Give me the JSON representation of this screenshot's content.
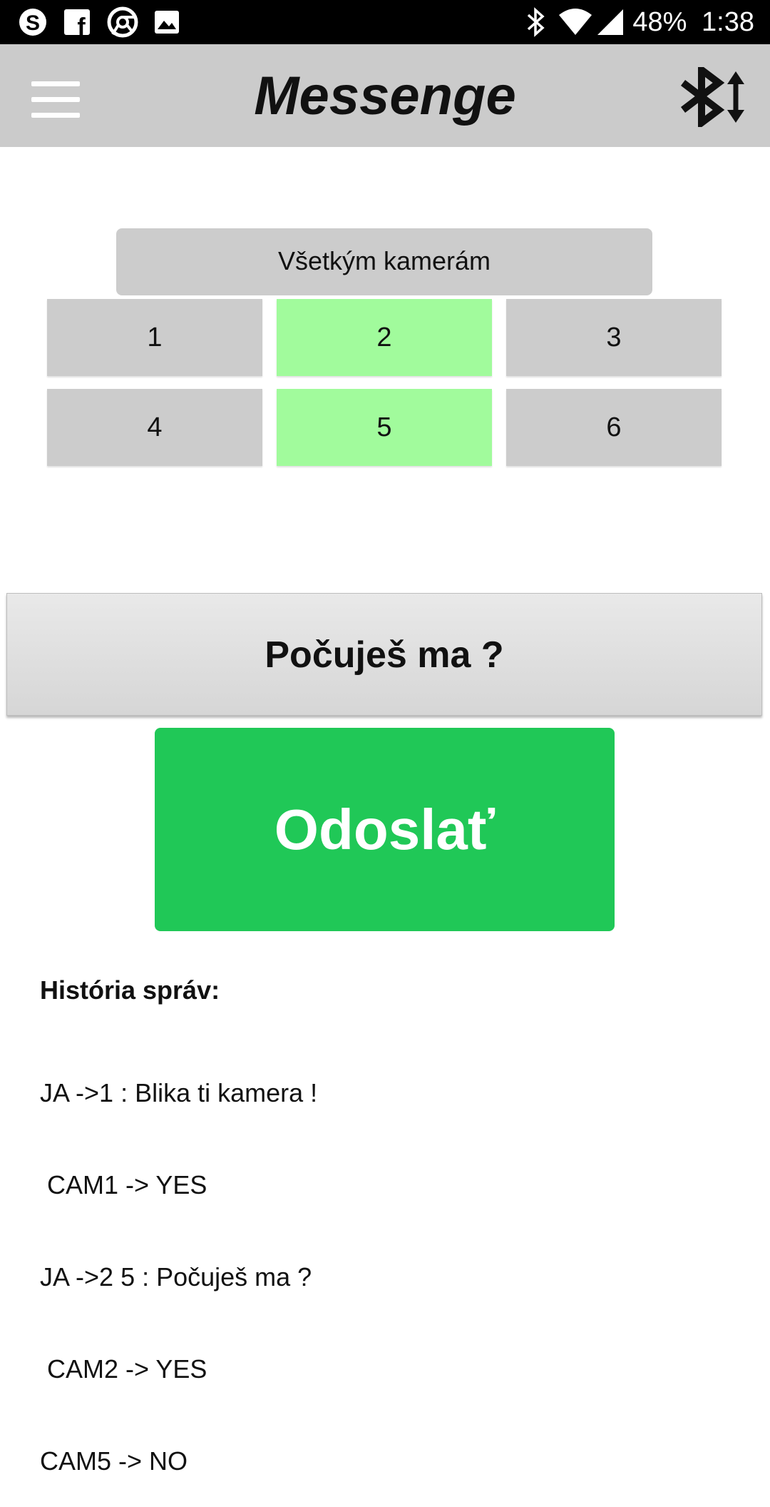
{
  "status_bar": {
    "left_icons": [
      "skype-icon",
      "facebook-icon",
      "chrome-icon",
      "gallery-icon"
    ],
    "right_icons": [
      "bluetooth-icon",
      "wifi-icon",
      "signal-icon"
    ],
    "battery": "48%",
    "time": "1:38"
  },
  "app_bar": {
    "title": "Messenge",
    "menu_icon": "hamburger-menu-icon",
    "action_icon": "bluetooth-transfer-icon"
  },
  "camera_select": {
    "all_label": "Všetkým kamerám",
    "cameras": [
      {
        "label": "1",
        "selected": false
      },
      {
        "label": "2",
        "selected": true
      },
      {
        "label": "3",
        "selected": false
      },
      {
        "label": "4",
        "selected": false
      },
      {
        "label": "5",
        "selected": true
      },
      {
        "label": "6",
        "selected": false
      }
    ],
    "selected_color": "#a1fb9c",
    "unselected_color": "#cccccc"
  },
  "message": {
    "value": "Počuješ ma ?"
  },
  "send_button": {
    "label": "Odoslať",
    "color": "#20c857"
  },
  "history": {
    "label": "História správ:",
    "lines": [
      "JA ->1 : Blika ti kamera !",
      " CAM1 -> YES",
      "JA ->2 5 : Počuješ ma ?",
      " CAM2 -> YES",
      "CAM5 -> NO"
    ]
  }
}
